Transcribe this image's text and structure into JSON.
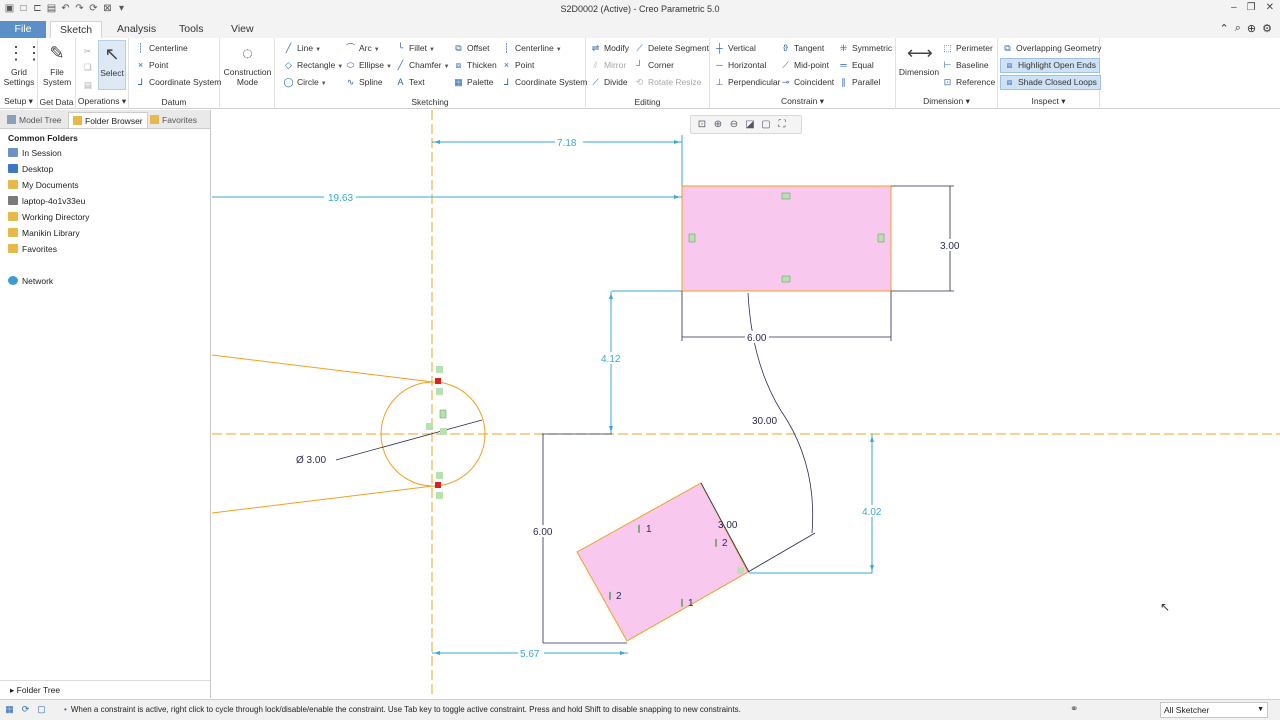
{
  "window": {
    "title": "S2D0002 (Active) - Creo Parametric 5.0",
    "qat_icons": [
      "app-icon",
      "new-icon",
      "open-icon",
      "save-icon",
      "undo-icon",
      "redo-icon",
      "regenerate-icon",
      "close-window-icon",
      "customize-icon"
    ],
    "controls": [
      "minimize-icon",
      "restore-icon",
      "close-icon"
    ]
  },
  "tabs": [
    "File",
    "Sketch",
    "Analysis",
    "Tools",
    "View"
  ],
  "active_tab": "Sketch",
  "ribbon": {
    "setup": {
      "grid_settings": "Grid Settings",
      "label": "Setup ▾"
    },
    "get_data": {
      "file_system": "File System",
      "label": "Get Data"
    },
    "operations": {
      "select": "Select",
      "label": "Operations ▾"
    },
    "datum": {
      "items": [
        "Centerline",
        "Point",
        "Coordinate System"
      ],
      "label": "Datum"
    },
    "construction": {
      "mode": "Construction Mode"
    },
    "sketching": {
      "col1": [
        "Line",
        "Rectangle",
        "Circle"
      ],
      "col2": [
        "Arc",
        "Ellipse",
        "Spline"
      ],
      "col3": [
        "Fillet",
        "Chamfer",
        "Text"
      ],
      "col4": [
        "Offset",
        "Thicken",
        "Palette"
      ],
      "col5": [
        "Centerline",
        "Point",
        "Coordinate System"
      ],
      "label": "Sketching"
    },
    "editing": {
      "col1": [
        "Modify",
        "Mirror",
        "Divide"
      ],
      "col2": [
        "Delete Segment",
        "Corner",
        "Rotate Resize"
      ],
      "label": "Editing"
    },
    "constrain": {
      "col1": [
        "Vertical",
        "Horizontal",
        "Perpendicular"
      ],
      "col2": [
        "Tangent",
        "Mid-point",
        "Coincident"
      ],
      "col3": [
        "Symmetric",
        "Equal",
        "Parallel"
      ],
      "label": "Constrain ▾"
    },
    "dimension": {
      "big": "Dimension",
      "items": [
        "Perimeter",
        "Baseline",
        "Reference"
      ],
      "label": "Dimension ▾"
    },
    "inspect": {
      "items": [
        "Overlapping Geometry",
        "Highlight Open Ends",
        "Shade Closed Loops"
      ],
      "label": "Inspect ▾"
    }
  },
  "left_panel": {
    "tabs": [
      "Model Tree",
      "Folder Browser",
      "Favorites"
    ],
    "active_tab": "Folder Browser",
    "section_title": "Common Folders",
    "folders": [
      "In Session",
      "Desktop",
      "My Documents",
      "laptop-4o1v33eu",
      "Working Directory",
      "Manikin Library",
      "Favorites"
    ],
    "network": "Network",
    "folder_tree": "Folder Tree"
  },
  "sketch": {
    "dimensions": {
      "d_718": "7.18",
      "d_1963": "19.63",
      "d_300_rect": "3.00",
      "d_600_rect": "6.00",
      "d_412": "4.12",
      "d_3000": "30.00",
      "d_dia": "Ø 3.00",
      "d_600_vert": "6.00",
      "d_300_rot": "3.00",
      "d_402": "4.02",
      "d_567": "5.67"
    },
    "constraint_labels": [
      "1",
      "2",
      "2",
      "1"
    ]
  },
  "status": {
    "message": "When a constraint is active, right click to cycle through lock/disable/enable the constraint. Use Tab key to toggle active constraint. Press and hold Shift to disable snapping to new constraints.",
    "filter": "All Sketcher"
  },
  "colors": {
    "dimension": "#3aa7d9",
    "geometry": "#f0a020",
    "shade": "#f8c8ee",
    "dim_dark": "#2a2a55",
    "file_tab": "#5b8fc7"
  }
}
